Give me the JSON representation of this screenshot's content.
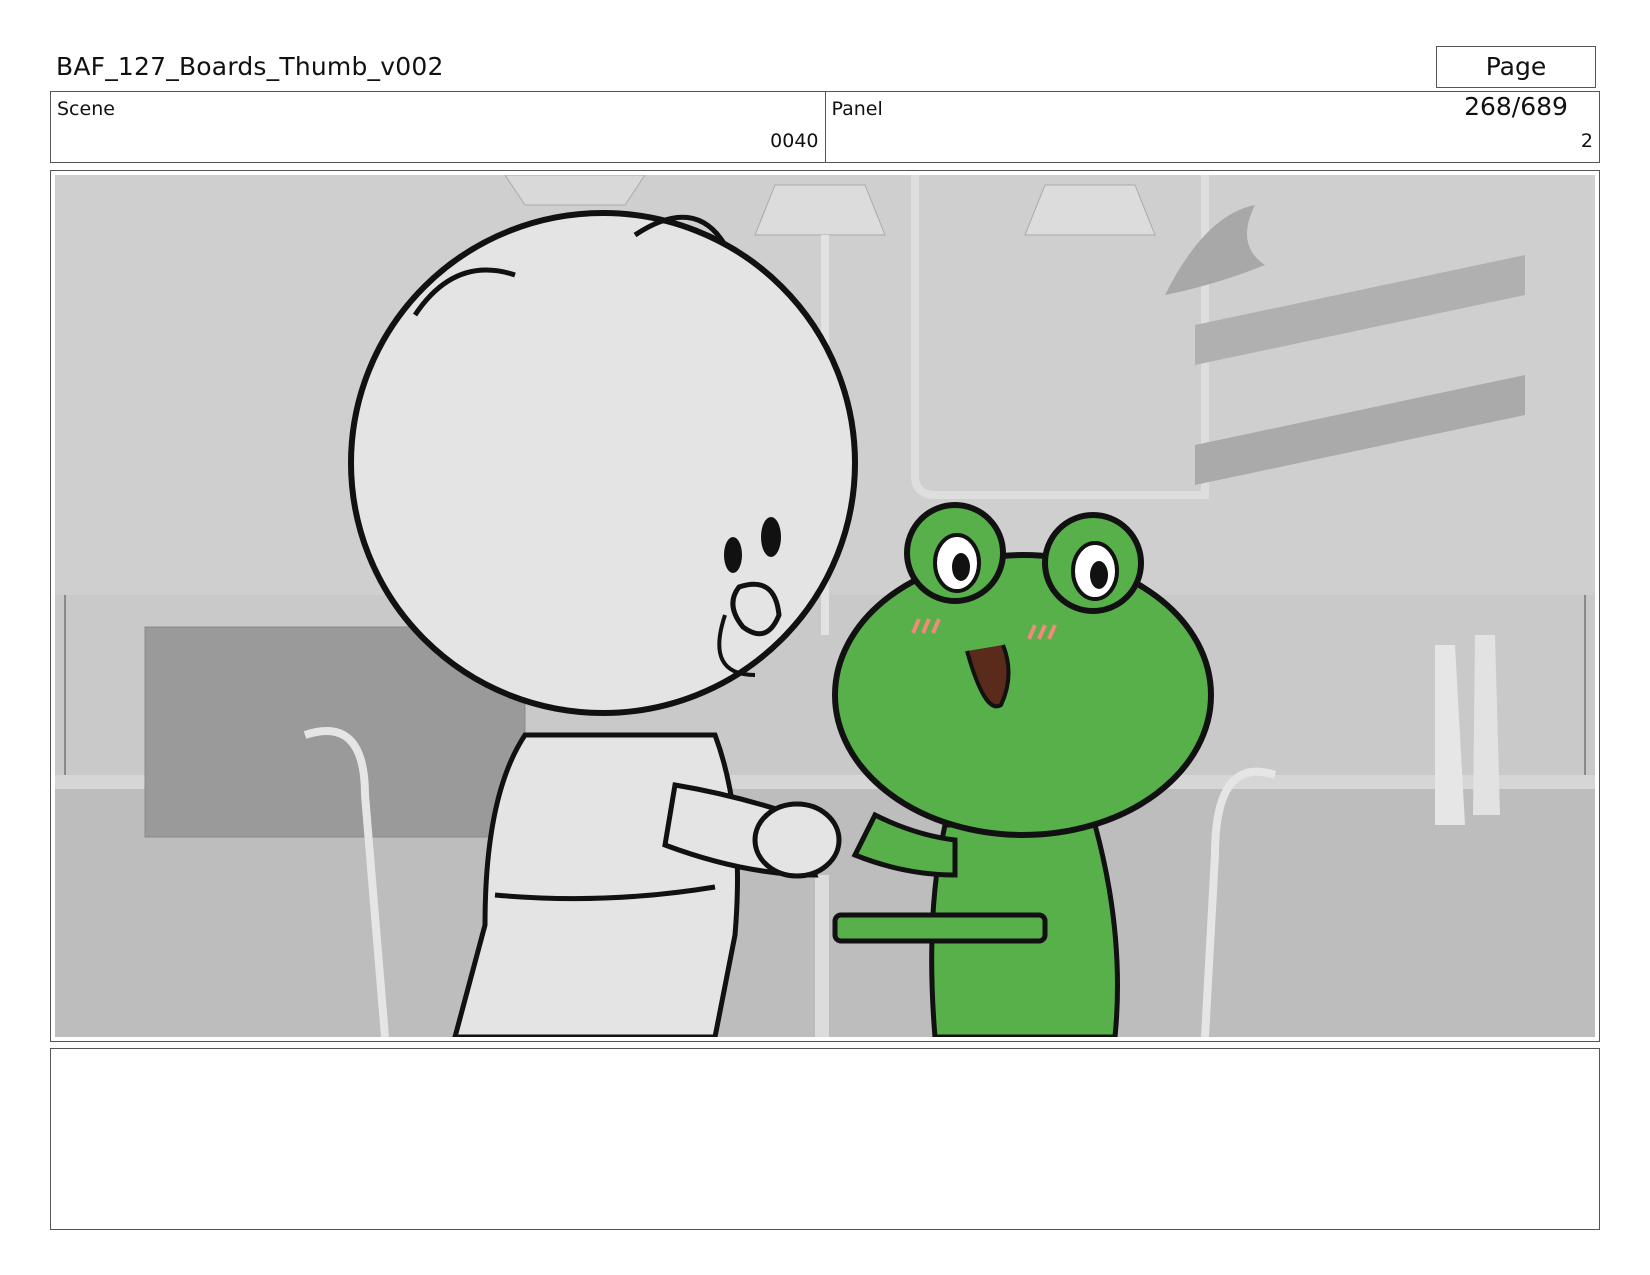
{
  "header": {
    "title": "BAF_127_Boards_Thumb_v002",
    "page": "Page 268/689"
  },
  "info": {
    "scene_label": "Scene",
    "scene_value": "0040",
    "panel_label": "Panel",
    "panel_value": "2"
  },
  "panel_image": {
    "characters": [
      "bear-character",
      "frog-character"
    ],
    "frog_color": "#58b04a",
    "background_tone": "#c8c8c8"
  },
  "notes": {
    "text": ""
  }
}
